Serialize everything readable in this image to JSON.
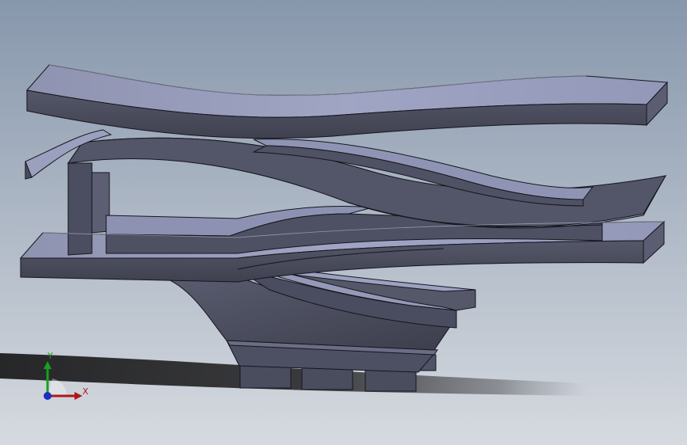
{
  "viewport": {
    "background_top": "#8797ac",
    "background_bottom": "#d6dae0",
    "part_colors": {
      "face_light": "#9a9fc0",
      "face_mid": "#7a7e98",
      "face_dark": "#4b4e60",
      "face_darker": "#3a3c4a",
      "edge": "#1a1a22"
    },
    "shadow_color": "#1e1e20"
  },
  "triad": {
    "x_label": "X",
    "y_label": "Y",
    "x_color": "#b01818",
    "y_color": "#18a020",
    "z_color": "#1830c0"
  }
}
